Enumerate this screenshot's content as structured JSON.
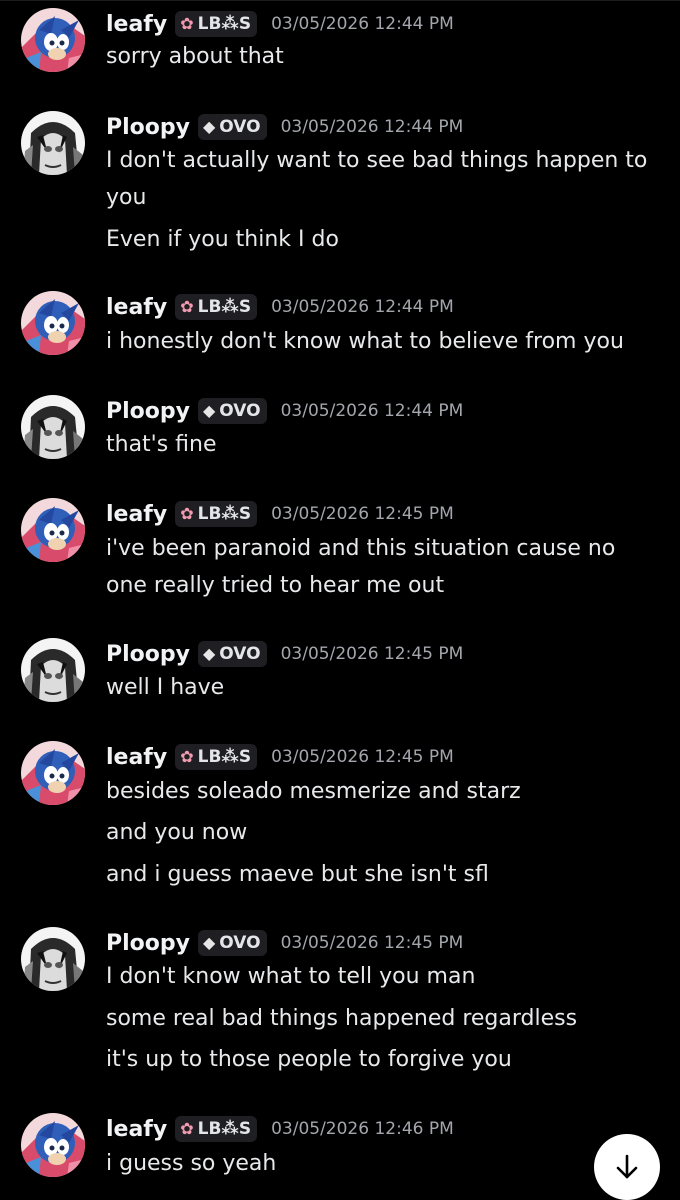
{
  "users": {
    "leafy": {
      "name": "leafy",
      "tag": "LB⁂S",
      "tag_icon": "flower-icon"
    },
    "ploopy": {
      "name": "Ploopy",
      "tag": "OVO",
      "tag_icon": "gem-icon"
    }
  },
  "messages": [
    {
      "author": "leafy",
      "time": "03/05/2026 12:44 PM",
      "lines": [
        "sorry about that"
      ]
    },
    {
      "author": "Ploopy",
      "time": "03/05/2026 12:44 PM",
      "lines": [
        "I don't actually want to see bad things happen to",
        "you",
        "Even if you think I do"
      ]
    },
    {
      "author": "leafy",
      "time": "03/05/2026 12:44 PM",
      "lines": [
        "i honestly don't know what to believe from you"
      ]
    },
    {
      "author": "Ploopy",
      "time": "03/05/2026 12:44 PM",
      "lines": [
        "that's fine"
      ]
    },
    {
      "author": "leafy",
      "time": "03/05/2026 12:45 PM",
      "lines": [
        "i've been paranoid and this situation cause no",
        "one really tried to hear me out"
      ]
    },
    {
      "author": "Ploopy",
      "time": "03/05/2026 12:45 PM",
      "lines": [
        "well I have"
      ]
    },
    {
      "author": "leafy",
      "time": "03/05/2026 12:45 PM",
      "lines": [
        "besides soleado mesmerize and starz",
        "and you now",
        "and i guess maeve but she isn't sfl"
      ]
    },
    {
      "author": "Ploopy",
      "time": "03/05/2026 12:45 PM",
      "lines": [
        "I don't know what to tell you man",
        "some real bad things happened regardless",
        "it's up to those people to forgive you"
      ]
    },
    {
      "author": "leafy",
      "time": "03/05/2026 12:46 PM",
      "lines": [
        "i guess so yeah"
      ]
    }
  ],
  "scroll_button": {
    "icon": "arrow-down-icon"
  },
  "colors": {
    "background": "#000000",
    "timestamp": "#a4a6ad",
    "tag_bg": "#1f1f23"
  }
}
